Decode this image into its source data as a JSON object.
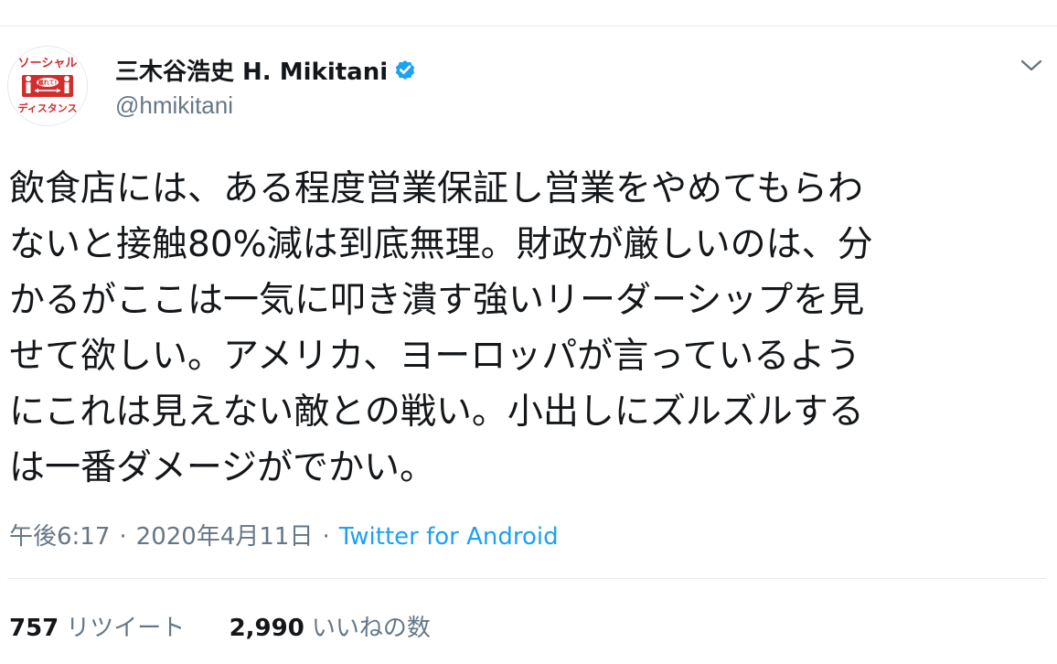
{
  "colors": {
    "text": "#14171a",
    "secondary": "#657786",
    "link": "#1da1f2",
    "verified": "#1da1f2",
    "divider": "#e6ecf0",
    "avatar_red": "#d22d2d"
  },
  "author": {
    "display_name": "三木谷浩史 H. Mikitani",
    "handle": "@hmikitani",
    "verified_icon": "verified-badge-icon",
    "avatar": {
      "top_text": "ソーシャル",
      "bubble_text": "離れて!",
      "bottom_text": "ディスタンス"
    }
  },
  "more_icon": "chevron-down-icon",
  "tweet": {
    "lines": [
      "飲食店には、ある程度営業保証し営業をやめてもらわ",
      "ないと接触80%減は到底無理。財政が厳しいのは、分",
      "かるがここは一気に叩き潰す強いリーダーシップを見",
      "せて欲しい。アメリカ、ヨーロッパが言っているよう",
      "にこれは見えない敵との戦い。小出しにズルズルする",
      "は一番ダメージがでかい。"
    ]
  },
  "meta": {
    "time": "午後6:17",
    "separator": "·",
    "date": "2020年4月11日",
    "source": "Twitter for Android"
  },
  "stats": {
    "retweets_count": "757",
    "retweets_label": "リツイート",
    "likes_count": "2,990",
    "likes_label": "いいねの数"
  }
}
